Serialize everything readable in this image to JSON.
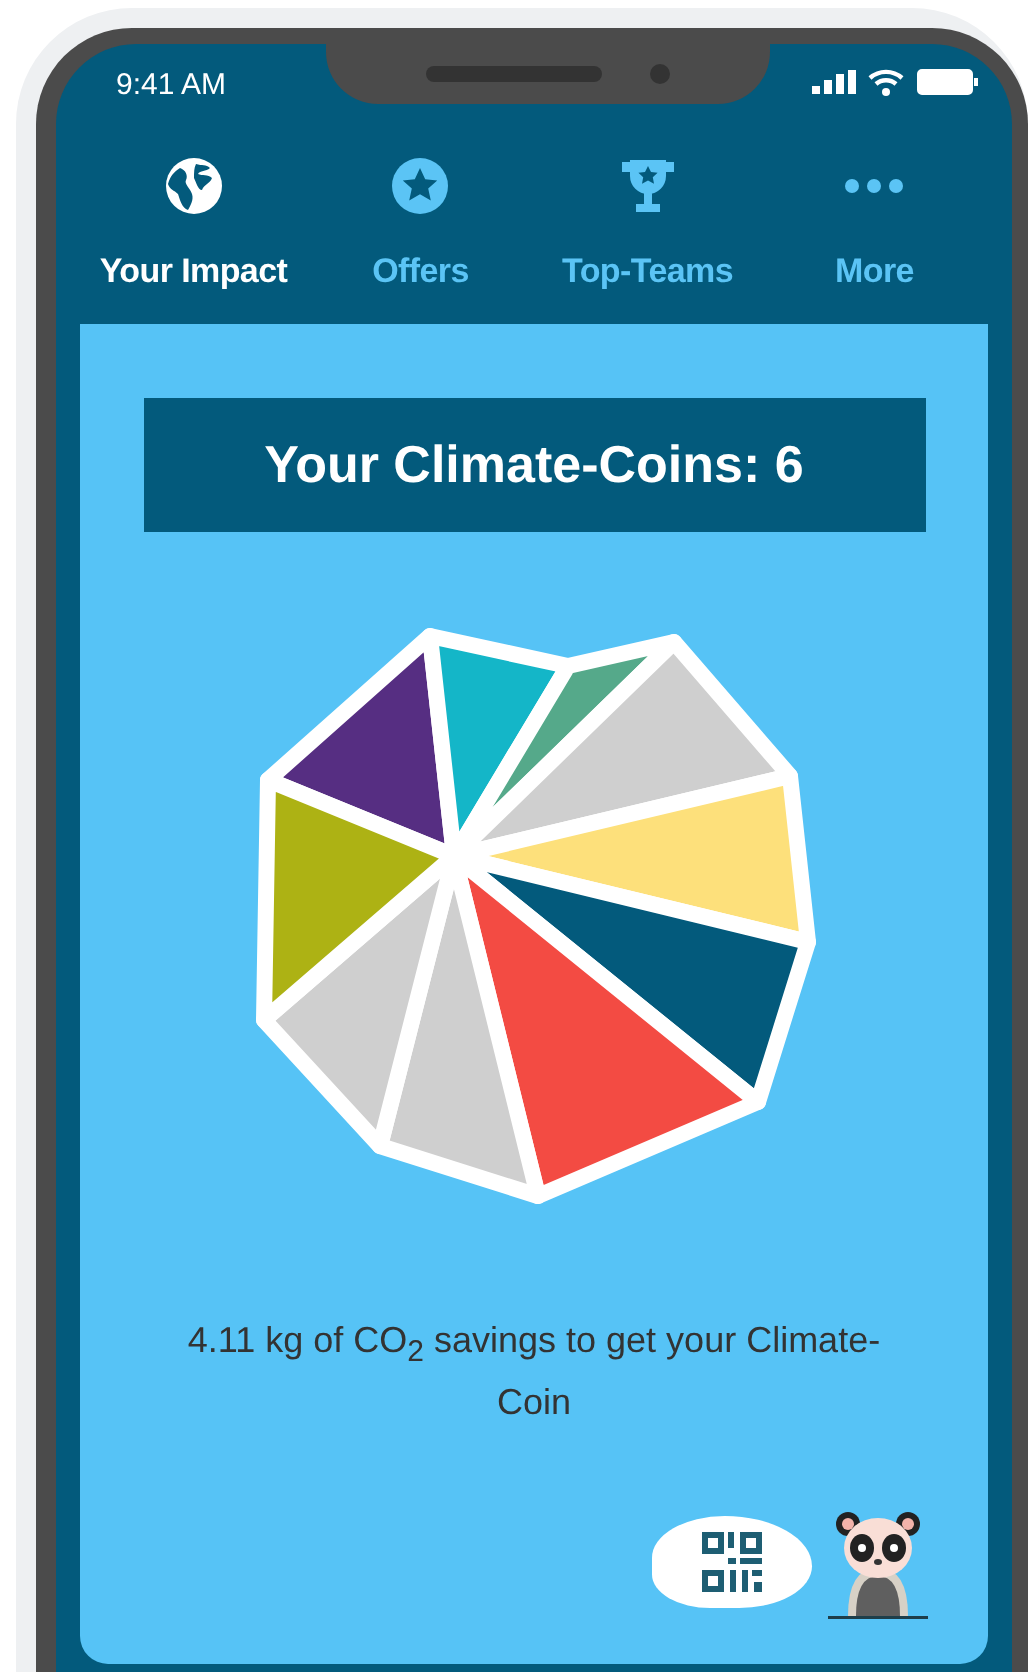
{
  "status_bar": {
    "time": "9:41 AM"
  },
  "tabs": [
    {
      "label": "Your Impact",
      "selected": true
    },
    {
      "label": "Offers",
      "selected": false
    },
    {
      "label": "Top-Teams",
      "selected": false
    },
    {
      "label": "More",
      "selected": false
    }
  ],
  "coins": {
    "title": "Your Climate-Coins: 6"
  },
  "progress": {
    "text": "4.11 kg of CO$_{2}$ savings to get your Climate-Coin"
  }
}
